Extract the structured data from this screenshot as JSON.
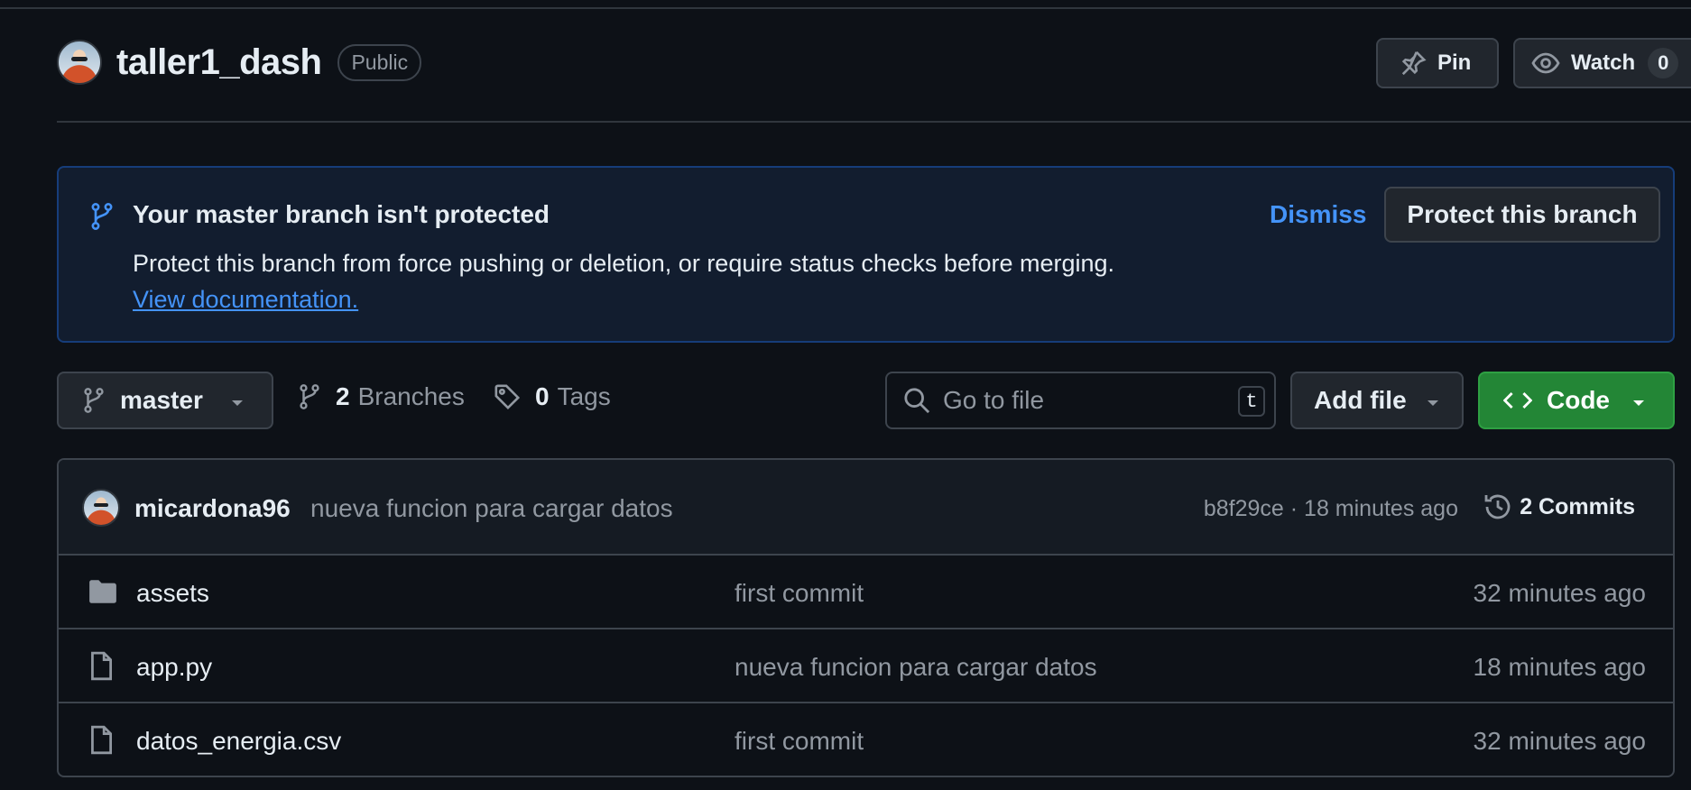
{
  "repo": {
    "name": "taller1_dash",
    "visibility": "Public"
  },
  "header_actions": {
    "pin_label": "Pin",
    "watch_label": "Watch",
    "watch_count": "0"
  },
  "banner": {
    "title": "Your master branch isn't protected",
    "text": "Protect this branch from force pushing or deletion, or require status checks before merging.",
    "link_label": "View documentation.",
    "dismiss_label": "Dismiss",
    "protect_label": "Protect this branch"
  },
  "toolbar": {
    "branch": "master",
    "branches_count": "2",
    "branches_label": "Branches",
    "tags_count": "0",
    "tags_label": "Tags",
    "search_placeholder": "Go to file",
    "search_shortcut": "t",
    "add_file_label": "Add file",
    "code_label": "Code"
  },
  "latest_commit": {
    "author": "micardona96",
    "message": "nueva funcion para cargar datos",
    "meta": "b8f29ce · 18 minutes ago",
    "commits_label": "2 Commits"
  },
  "files": [
    {
      "name": "assets",
      "type": "folder",
      "commit": "first commit",
      "age": "32 minutes ago"
    },
    {
      "name": "app.py",
      "type": "file",
      "commit": "nueva funcion para cargar datos",
      "age": "18 minutes ago"
    },
    {
      "name": "datos_energia.csv",
      "type": "file",
      "commit": "first commit",
      "age": "32 minutes ago"
    }
  ],
  "colors": {
    "background": "#0d1117",
    "accent_blue": "#4493f8",
    "code_green": "#238636"
  },
  "icons": [
    "pin-icon",
    "eye-icon",
    "git-branch-icon",
    "tag-icon",
    "search-icon",
    "code-icon",
    "history-icon",
    "folder-icon",
    "file-icon",
    "chevron-down-icon"
  ]
}
